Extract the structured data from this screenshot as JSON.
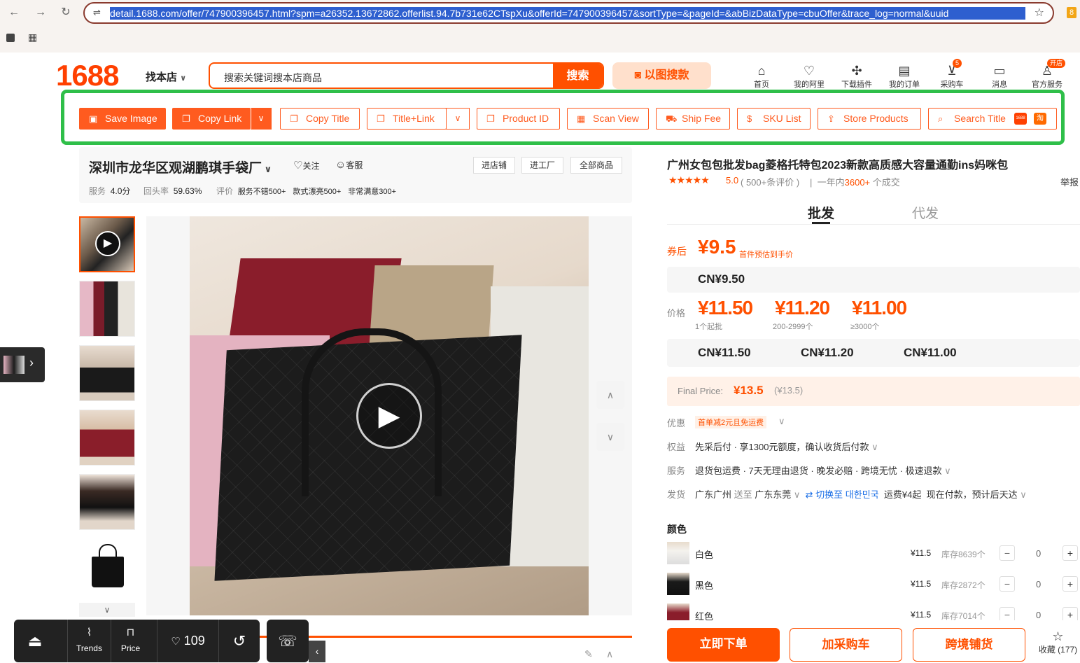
{
  "browser": {
    "url": "detail.1688.com/offer/747900396457.html?spm=a26352.13672862.offerlist.94.7b731e62CTspXu&offerId=747900396457&sortType=&pageId=&abBizDataType=cbuOffer&trace_log=normal&uuid",
    "ext_badge": "8"
  },
  "header": {
    "logo": "1688",
    "shop_finder": "找本店",
    "search_placeholder": "搜索关键词搜本店商品",
    "search_button": "搜索",
    "image_search": "以图搜款",
    "nav": [
      {
        "label": "首页",
        "icon": "home-icon"
      },
      {
        "label": "我的阿里",
        "icon": "heart-shield-icon"
      },
      {
        "label": "下载插件",
        "icon": "puzzle-icon"
      },
      {
        "label": "我的订单",
        "icon": "clipboard-icon"
      },
      {
        "label": "采购车",
        "icon": "cart-icon",
        "badge": "5"
      },
      {
        "label": "消息",
        "icon": "chat-icon"
      },
      {
        "label": "官方服务",
        "icon": "user-icon",
        "badge": "开店"
      }
    ]
  },
  "toolbar": {
    "save_image": "Save Image",
    "copy_link": "Copy Link",
    "copy_title": "Copy Title",
    "title_link": "Title+Link",
    "product_id": "Product ID",
    "scan_view": "Scan View",
    "ship_fee": "Ship Fee",
    "sku_list": "SKU List",
    "store_products": "Store Products",
    "search_title": "Search Title",
    "badge_1688": "1688",
    "badge_tao": "淘"
  },
  "shop": {
    "name": "深圳市龙华区观湖鹏琪手袋厂",
    "follow": "关注",
    "service": "客服",
    "btn_store": "进店铺",
    "btn_factory": "进工厂",
    "btn_all": "全部商品",
    "stat_service_label": "服务",
    "stat_service_value": "4.0分",
    "stat_repurchase_label": "回头率",
    "stat_repurchase_value": "59.63%",
    "stat_review_label": "评价",
    "tags": [
      "服务不错500+",
      "款式漂亮500+",
      "非常满意300+"
    ]
  },
  "product": {
    "title": "广州女包包批发bag菱格托特包2023新款高质感大容量通勤ins妈咪包",
    "rating": "5.0",
    "reviews": "( 500+条评价 )",
    "sold_prefix": "一年内",
    "sold_count": "3600+",
    "sold_suffix": "个成交",
    "report": "举报",
    "tab_wholesale": "批发",
    "tab_dropship": "代发",
    "coupon_label": "券后",
    "coupon_price": "¥9.5",
    "coupon_note": "首件预估到手价",
    "coupon_cny": "CN¥9.50",
    "price_label": "价格",
    "tiers": [
      {
        "price": "¥11.50",
        "range": "1个起批",
        "cny": "CN¥11.50"
      },
      {
        "price": "¥11.20",
        "range": "200-2999个",
        "cny": "CN¥11.20"
      },
      {
        "price": "¥11.00",
        "range": "≥3000个",
        "cny": "CN¥11.00"
      }
    ],
    "final_label": "Final Price:",
    "final_price": "¥13.5",
    "final_paren": "(¥13.5)",
    "promo_label": "优惠",
    "promo_value": "首单减2元且免运费",
    "rights_label": "权益",
    "rights_value": "先采后付 · 享1300元额度，确认收货后付款",
    "service_label": "服务",
    "service_value": "退货包运费 · 7天无理由退货 · 晚发必赔 · 跨境无忧 · 极速退款",
    "ship_label": "发货",
    "ship_from": "广东广州",
    "ship_to_word": "送至",
    "ship_to": "广东东莞",
    "ship_switch": "⇄ 切换至 대한민국",
    "ship_fee": "运费¥4起",
    "ship_eta": "现在付款，预计后天达",
    "color_label": "颜色",
    "skus": [
      {
        "name": "白色",
        "price": "¥11.5",
        "stock": "库存8639个",
        "qty": "0"
      },
      {
        "name": "黑色",
        "price": "¥11.5",
        "stock": "库存2872个",
        "qty": "0"
      },
      {
        "name": "红色",
        "price": "¥11.5",
        "stock": "库存7014个",
        "qty": "0"
      }
    ],
    "buy_now": "立即下单",
    "add_cart": "加采购车",
    "cross_border": "跨境铺货",
    "favorite": "收藏 (177)"
  },
  "floatbar": {
    "trends": "Trends",
    "price": "Price",
    "likes": "109"
  },
  "colors": {
    "accent": "#ff5000",
    "toolbar_border": "#2fbf49",
    "toolbar_btn": "#ff5b1f"
  }
}
